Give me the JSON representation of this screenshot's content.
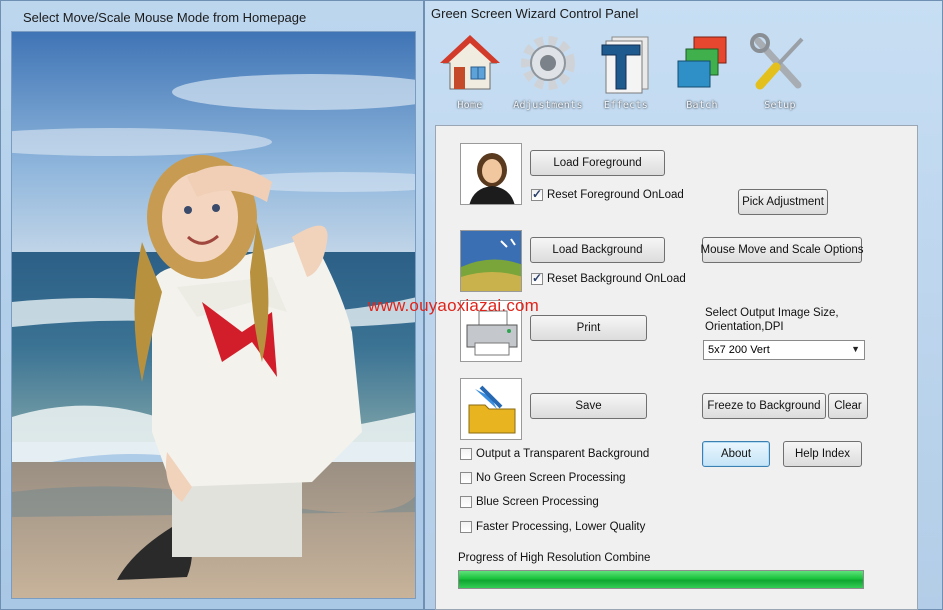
{
  "left_window": {
    "title": "Select Move/Scale Mouse Mode from Homepage"
  },
  "right_window": {
    "title": "Green Screen Wizard Control Panel"
  },
  "toolbar": [
    {
      "label": "Home",
      "icon": "house-icon"
    },
    {
      "label": "Adjustments",
      "icon": "gear-icon"
    },
    {
      "label": "Effects",
      "icon": "effects-t-icon"
    },
    {
      "label": "Batch",
      "icon": "stacked-frames-icon"
    },
    {
      "label": "Setup",
      "icon": "wrench-screwdriver-icon"
    }
  ],
  "panel": {
    "load_foreground": "Load Foreground",
    "reset_foreground": {
      "label": "Reset Foreground OnLoad",
      "checked": true
    },
    "pick_adjustment": "Pick Adjustment",
    "load_background": "Load Background",
    "reset_background": {
      "label": "Reset Background OnLoad",
      "checked": true
    },
    "mouse_move_scale": "Mouse Move and Scale Options",
    "print": "Print",
    "output_size_label": "Select Output Image Size, Orientation,DPI",
    "output_size_value": "5x7 200 Vert",
    "save": "Save",
    "freeze_background": "Freeze to Background",
    "clear": "Clear",
    "about": "About",
    "help_index": "Help Index",
    "options": [
      {
        "label": "Output a Transparent Background",
        "checked": false
      },
      {
        "label": "No Green Screen Processing",
        "checked": false
      },
      {
        "label": "Blue Screen Processing",
        "checked": false
      },
      {
        "label": "Faster Processing, Lower Quality",
        "checked": false
      }
    ],
    "progress_label": "Progress of High Resolution Combine",
    "progress_fraction": 1.0
  },
  "watermark": "www.ouyaoxiazai.com",
  "colors": {
    "progress": "#19c23c",
    "watermark": "#e0241b",
    "accent": "#3c7fb1"
  }
}
